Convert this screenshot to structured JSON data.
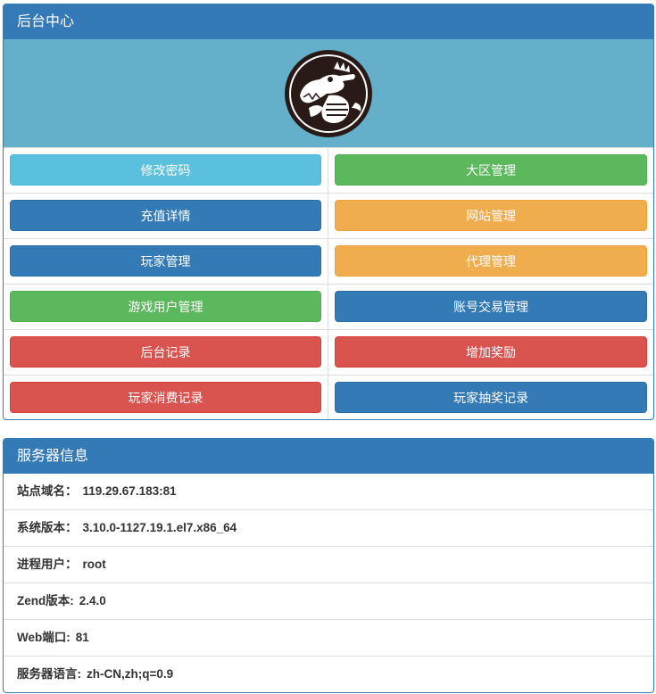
{
  "admin_panel": {
    "title": "后台中心",
    "buttons": [
      {
        "label": "修改密码",
        "style": "info"
      },
      {
        "label": "大区管理",
        "style": "success"
      },
      {
        "label": "充值详情",
        "style": "primary"
      },
      {
        "label": "网站管理",
        "style": "warning"
      },
      {
        "label": "玩家管理",
        "style": "primary"
      },
      {
        "label": "代理管理",
        "style": "warning"
      },
      {
        "label": "游戏用户管理",
        "style": "success"
      },
      {
        "label": "账号交易管理",
        "style": "primary"
      },
      {
        "label": "后台记录",
        "style": "danger"
      },
      {
        "label": "增加奖励",
        "style": "danger"
      },
      {
        "label": "玩家消费记录",
        "style": "danger"
      },
      {
        "label": "玩家抽奖记录",
        "style": "primary"
      }
    ],
    "logo_icon": "crocodile-logo-icon"
  },
  "server_panel": {
    "title": "服务器信息",
    "rows": [
      {
        "label": "站点域名：",
        "value": "119.29.67.183:81"
      },
      {
        "label": "系统版本：",
        "value": "3.10.0-1127.19.1.el7.x86_64"
      },
      {
        "label": "进程用户：",
        "value": "root"
      },
      {
        "label": "Zend版本:",
        "value": "2.4.0"
      },
      {
        "label": "Web端口:",
        "value": "81"
      },
      {
        "label": "服务器语言:",
        "value": "zh-CN,zh;q=0.9"
      }
    ]
  },
  "colors": {
    "primary": "#337ab7",
    "info": "#5bc0de",
    "success": "#5cb85c",
    "warning": "#f0ad4e",
    "danger": "#d9534f",
    "logo_bg": "#64b0cb"
  }
}
